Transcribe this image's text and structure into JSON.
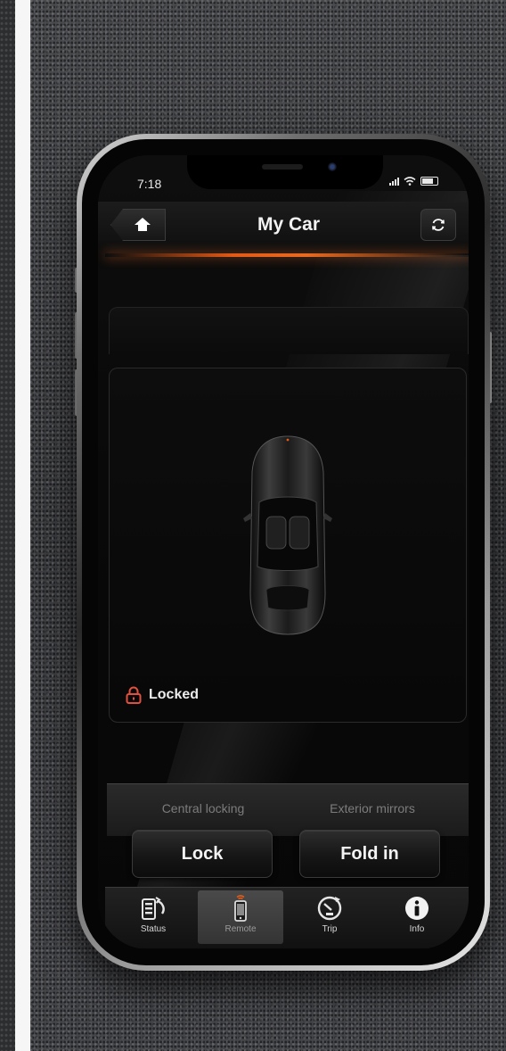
{
  "status_bar": {
    "time": "7:18"
  },
  "header": {
    "title": "My Car"
  },
  "vehicle": {
    "lock_status": "Locked"
  },
  "controls": [
    {
      "label": "Central locking",
      "button": "Lock"
    },
    {
      "label": "Exterior mirrors",
      "button": "Fold in"
    }
  ],
  "tabs": [
    {
      "label": "Status",
      "icon": "status-icon"
    },
    {
      "label": "Remote",
      "icon": "remote-icon",
      "active": true
    },
    {
      "label": "Trip",
      "icon": "trip-icon"
    },
    {
      "label": "Info",
      "icon": "info-icon"
    }
  ],
  "colors": {
    "accent": "#e25a18",
    "lock_icon": "#e0503e",
    "background": "#080808"
  }
}
